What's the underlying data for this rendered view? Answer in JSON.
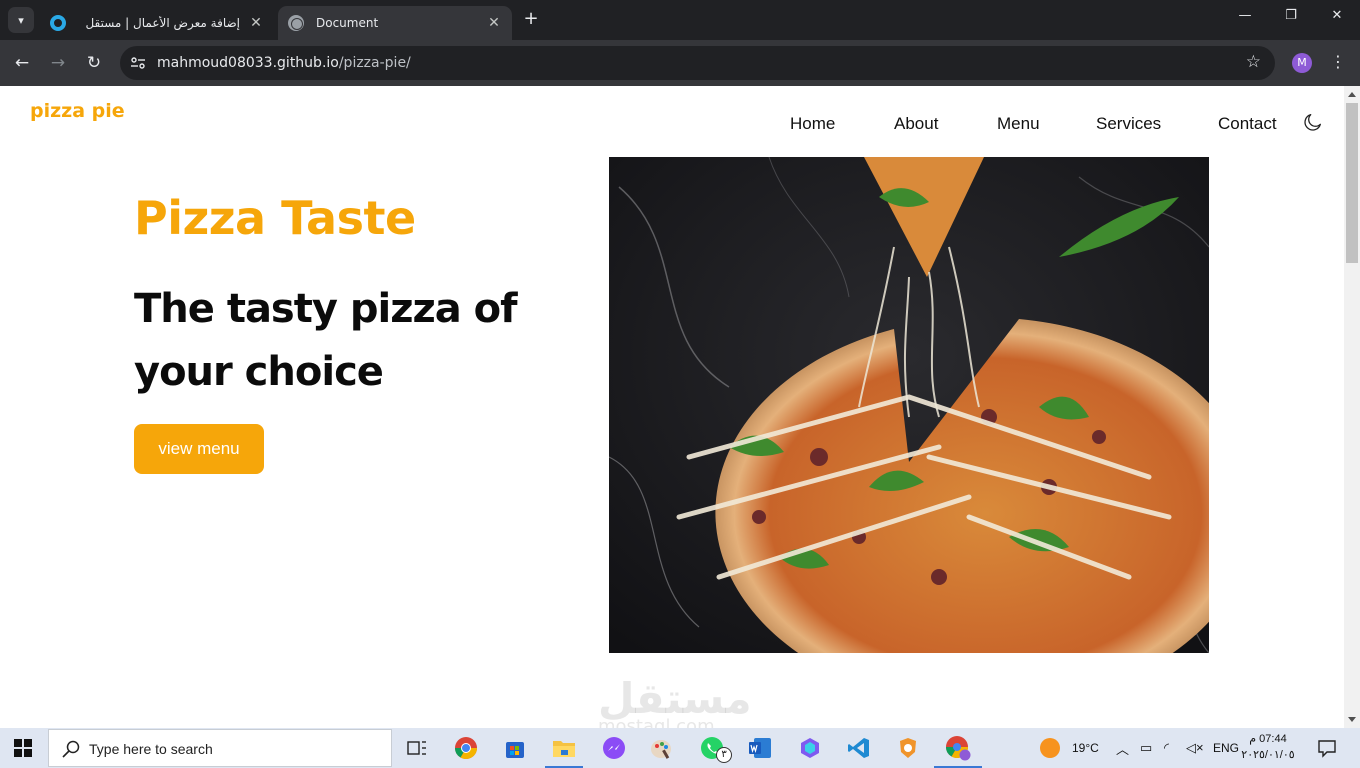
{
  "browser": {
    "tabs": [
      {
        "title": "إضافة معرض الأعمال | مستقل",
        "close": "✕"
      },
      {
        "title": "Document",
        "close": "✕"
      }
    ],
    "new_tab": "+",
    "window_controls": {
      "minimize": "—",
      "restore": "❐",
      "close": "✕"
    },
    "url_host": "mahmoud08033.github.io",
    "url_path": "/pizza-pie/",
    "profile_initial": "M"
  },
  "site": {
    "logo": "pizza pie",
    "nav": [
      "Home",
      "About",
      "Menu",
      "Services",
      "Contact"
    ],
    "hero": {
      "title": "Pizza Taste",
      "heading": "The tasty pizza of your choice",
      "button": "view menu"
    },
    "watermark": "مستقل",
    "watermark_sub": "mostaql.com"
  },
  "taskbar": {
    "search_placeholder": "Type here to search",
    "apps": [
      "task-view",
      "chrome",
      "microsoft-store",
      "file-explorer",
      "messenger",
      "paint",
      "whatsapp",
      "word",
      "copilot",
      "vs-code",
      "brave",
      "chrome-profile"
    ],
    "whatsapp_badge": "٣",
    "weather": "19°C",
    "language": "ENG",
    "time": "07:44 م",
    "date": "٢٠٢٥/٠١/٠٥"
  },
  "colors": {
    "accent": "#f6a60a",
    "heading": "#0b0b0b",
    "chrome_dark": "#202124",
    "chrome_tab": "#35363a",
    "taskbar": "#dfe6f2"
  }
}
